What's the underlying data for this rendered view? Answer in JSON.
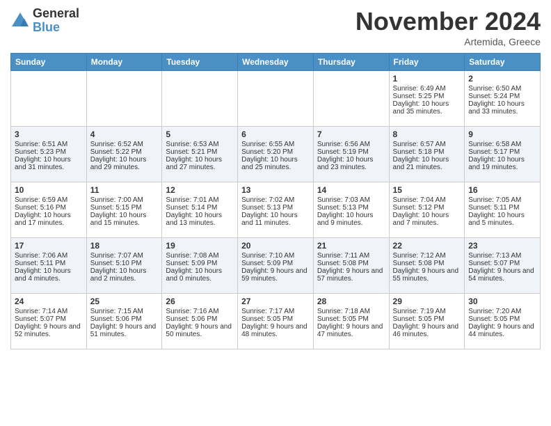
{
  "logo": {
    "general": "General",
    "blue": "Blue"
  },
  "title": "November 2024",
  "subtitle": "Artemida, Greece",
  "days_header": [
    "Sunday",
    "Monday",
    "Tuesday",
    "Wednesday",
    "Thursday",
    "Friday",
    "Saturday"
  ],
  "weeks": [
    [
      {
        "day": "",
        "content": ""
      },
      {
        "day": "",
        "content": ""
      },
      {
        "day": "",
        "content": ""
      },
      {
        "day": "",
        "content": ""
      },
      {
        "day": "",
        "content": ""
      },
      {
        "day": "1",
        "content": "Sunrise: 6:49 AM\nSunset: 5:25 PM\nDaylight: 10 hours and 35 minutes."
      },
      {
        "day": "2",
        "content": "Sunrise: 6:50 AM\nSunset: 5:24 PM\nDaylight: 10 hours and 33 minutes."
      }
    ],
    [
      {
        "day": "3",
        "content": "Sunrise: 6:51 AM\nSunset: 5:23 PM\nDaylight: 10 hours and 31 minutes."
      },
      {
        "day": "4",
        "content": "Sunrise: 6:52 AM\nSunset: 5:22 PM\nDaylight: 10 hours and 29 minutes."
      },
      {
        "day": "5",
        "content": "Sunrise: 6:53 AM\nSunset: 5:21 PM\nDaylight: 10 hours and 27 minutes."
      },
      {
        "day": "6",
        "content": "Sunrise: 6:55 AM\nSunset: 5:20 PM\nDaylight: 10 hours and 25 minutes."
      },
      {
        "day": "7",
        "content": "Sunrise: 6:56 AM\nSunset: 5:19 PM\nDaylight: 10 hours and 23 minutes."
      },
      {
        "day": "8",
        "content": "Sunrise: 6:57 AM\nSunset: 5:18 PM\nDaylight: 10 hours and 21 minutes."
      },
      {
        "day": "9",
        "content": "Sunrise: 6:58 AM\nSunset: 5:17 PM\nDaylight: 10 hours and 19 minutes."
      }
    ],
    [
      {
        "day": "10",
        "content": "Sunrise: 6:59 AM\nSunset: 5:16 PM\nDaylight: 10 hours and 17 minutes."
      },
      {
        "day": "11",
        "content": "Sunrise: 7:00 AM\nSunset: 5:15 PM\nDaylight: 10 hours and 15 minutes."
      },
      {
        "day": "12",
        "content": "Sunrise: 7:01 AM\nSunset: 5:14 PM\nDaylight: 10 hours and 13 minutes."
      },
      {
        "day": "13",
        "content": "Sunrise: 7:02 AM\nSunset: 5:13 PM\nDaylight: 10 hours and 11 minutes."
      },
      {
        "day": "14",
        "content": "Sunrise: 7:03 AM\nSunset: 5:13 PM\nDaylight: 10 hours and 9 minutes."
      },
      {
        "day": "15",
        "content": "Sunrise: 7:04 AM\nSunset: 5:12 PM\nDaylight: 10 hours and 7 minutes."
      },
      {
        "day": "16",
        "content": "Sunrise: 7:05 AM\nSunset: 5:11 PM\nDaylight: 10 hours and 5 minutes."
      }
    ],
    [
      {
        "day": "17",
        "content": "Sunrise: 7:06 AM\nSunset: 5:11 PM\nDaylight: 10 hours and 4 minutes."
      },
      {
        "day": "18",
        "content": "Sunrise: 7:07 AM\nSunset: 5:10 PM\nDaylight: 10 hours and 2 minutes."
      },
      {
        "day": "19",
        "content": "Sunrise: 7:08 AM\nSunset: 5:09 PM\nDaylight: 10 hours and 0 minutes."
      },
      {
        "day": "20",
        "content": "Sunrise: 7:10 AM\nSunset: 5:09 PM\nDaylight: 9 hours and 59 minutes."
      },
      {
        "day": "21",
        "content": "Sunrise: 7:11 AM\nSunset: 5:08 PM\nDaylight: 9 hours and 57 minutes."
      },
      {
        "day": "22",
        "content": "Sunrise: 7:12 AM\nSunset: 5:08 PM\nDaylight: 9 hours and 55 minutes."
      },
      {
        "day": "23",
        "content": "Sunrise: 7:13 AM\nSunset: 5:07 PM\nDaylight: 9 hours and 54 minutes."
      }
    ],
    [
      {
        "day": "24",
        "content": "Sunrise: 7:14 AM\nSunset: 5:07 PM\nDaylight: 9 hours and 52 minutes."
      },
      {
        "day": "25",
        "content": "Sunrise: 7:15 AM\nSunset: 5:06 PM\nDaylight: 9 hours and 51 minutes."
      },
      {
        "day": "26",
        "content": "Sunrise: 7:16 AM\nSunset: 5:06 PM\nDaylight: 9 hours and 50 minutes."
      },
      {
        "day": "27",
        "content": "Sunrise: 7:17 AM\nSunset: 5:05 PM\nDaylight: 9 hours and 48 minutes."
      },
      {
        "day": "28",
        "content": "Sunrise: 7:18 AM\nSunset: 5:05 PM\nDaylight: 9 hours and 47 minutes."
      },
      {
        "day": "29",
        "content": "Sunrise: 7:19 AM\nSunset: 5:05 PM\nDaylight: 9 hours and 46 minutes."
      },
      {
        "day": "30",
        "content": "Sunrise: 7:20 AM\nSunset: 5:05 PM\nDaylight: 9 hours and 44 minutes."
      }
    ]
  ]
}
